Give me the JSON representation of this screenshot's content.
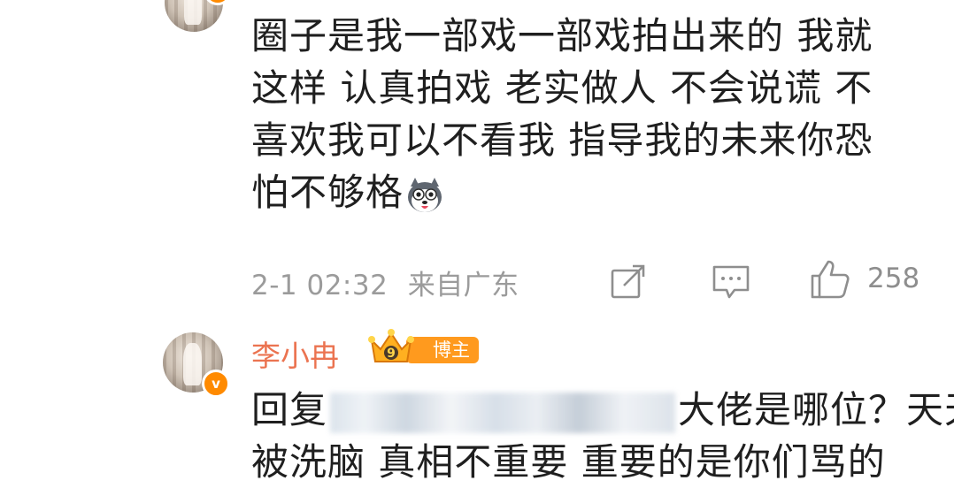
{
  "comment1": {
    "lines": [
      "圈子是我一部戏一部戏拍出来的 我就",
      "这样 认真拍戏 老实做人 不会说谎 不",
      "喜欢我可以不看我 指导我的未来你恐",
      "怕不够格"
    ],
    "emoji": "dog-emoji",
    "time": "2-1 02:32",
    "location": "来自广东",
    "like_count": "258"
  },
  "comment2": {
    "username": "李小冉",
    "level_number": "9",
    "badge_label": "博主",
    "reply_prefix": "回复",
    "line1_rest": "大佬是哪位？天天",
    "line2": "被洗脑 真相不重要 重要的是你们骂的"
  },
  "colors": {
    "username": "#eb7350",
    "verified_badge": "#ff8a00",
    "meta_text": "#9b9b9b"
  }
}
